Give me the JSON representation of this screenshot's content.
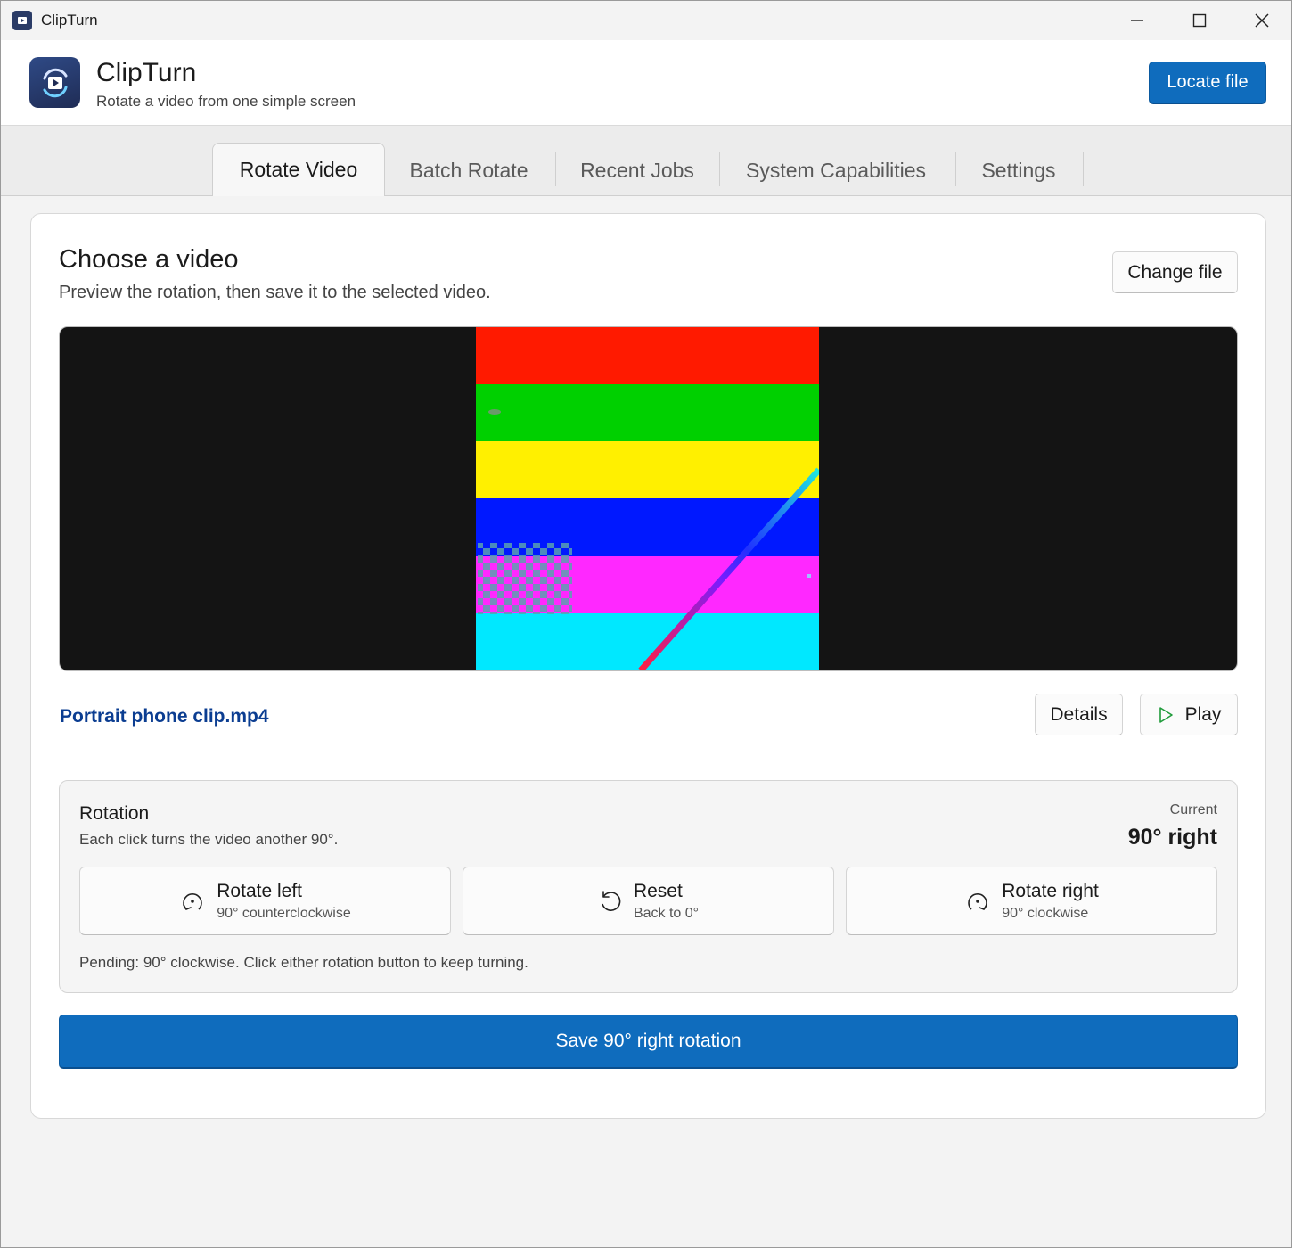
{
  "window": {
    "title": "ClipTurn",
    "controls": [
      "minimize",
      "maximize",
      "close"
    ]
  },
  "header": {
    "app_name": "ClipTurn",
    "subtitle": "Rotate a video from one simple screen",
    "locate_label": "Locate file"
  },
  "tabs": [
    {
      "label": "Rotate Video",
      "active": true
    },
    {
      "label": "Batch Rotate",
      "active": false
    },
    {
      "label": "Recent Jobs",
      "active": false
    },
    {
      "label": "System Capabilities",
      "active": false
    },
    {
      "label": "Settings",
      "active": false
    }
  ],
  "main": {
    "title": "Choose a video",
    "subtitle": "Preview the rotation, then save it to the selected video.",
    "change_label": "Change file",
    "file_name": "Portrait phone clip.mp4",
    "details_label": "Details",
    "play_label": "Play",
    "preview_stripes": [
      "#ff1a00",
      "#00d000",
      "#fff000",
      "#0018ff",
      "#ff28ff",
      "#00e8ff"
    ]
  },
  "rotation": {
    "title": "Rotation",
    "subtitle": "Each click turns the video another 90°.",
    "current_label": "Current",
    "current_value": "90° right",
    "buttons": [
      {
        "label": "Rotate left",
        "sub": "90° counterclockwise",
        "icon": "rotate-left-icon"
      },
      {
        "label": "Reset",
        "sub": "Back to 0°",
        "icon": "reset-icon"
      },
      {
        "label": "Rotate right",
        "sub": "90° clockwise",
        "icon": "rotate-right-icon"
      }
    ],
    "pending": "Pending: 90° clockwise. Click either rotation button to keep turning."
  },
  "save_label": "Save 90° right rotation",
  "colors": {
    "accent": "#0f6cbd",
    "link": "#0b3d91",
    "play_icon": "#1f9b3a"
  }
}
